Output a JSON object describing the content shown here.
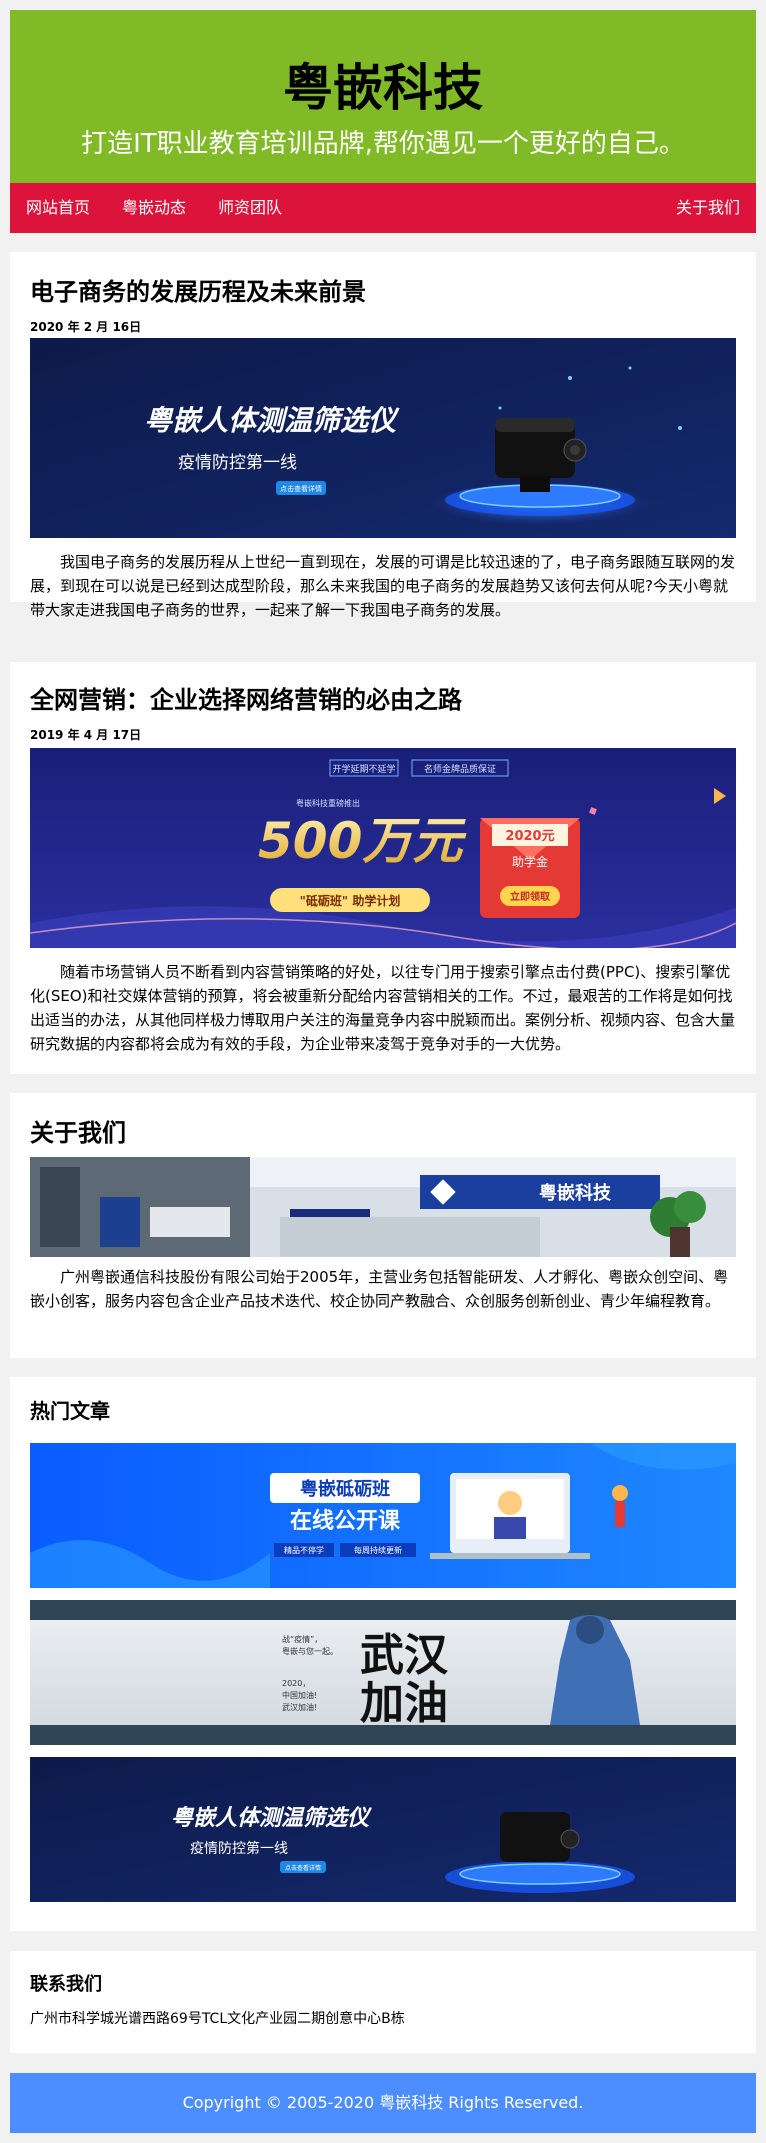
{
  "header": {
    "title": "粤嵌科技",
    "slogan": "打造IT职业教育培训品牌,帮你遇见一个更好的自己。"
  },
  "nav": {
    "items": [
      "网站首页",
      "粤嵌动态",
      "师资团队"
    ],
    "right": "关于我们"
  },
  "colors": {
    "header_bg": "#80ba26",
    "nav_bg": "#dc143c",
    "footer_bg": "#4c8dff"
  },
  "articles": [
    {
      "title": "电子商务的发展历程及未来前景",
      "date": "2020 年 2 月 16日",
      "body": "我国电子商务的发展历程从上世纪一直到现在，发展的可谓是比较迅速的了，电子商务跟随互联网的发展，到现在可以说是已经到达成型阶段，那么未来我国的电子商务的发展趋势又该何去何从呢?今天小粤就带大家走进我国电子商务的世界，一起来了解一下我国电子商务的发展。",
      "banner": {
        "headline": "粤嵌人体测温筛选仪",
        "sub": "疫情防控第一线",
        "button": "点击查看详情"
      }
    },
    {
      "title": "全网营销：企业选择网络营销的必由之路",
      "date": "2019 年 4 月 17日",
      "body": "随着市场营销人员不断看到内容营销策略的好处，以往专门用于搜索引擎点击付费(PPC)、搜索引擎优化(SEO)和社交媒体营销的预算，将会被重新分配给内容营销相关的工作。不过，最艰苦的工作将是如何找出适当的办法，从其他同样极力博取用户关注的海量竞争内容中脱颖而出。案例分析、视频内容、包含大量研究数据的内容都将会成为有效的手段，为企业带来凌驾于竞争对手的一大优势。",
      "banner": {
        "tag1": "开学延期不延学",
        "tag2": "名师金牌品质保证",
        "top": "粤嵌科技重磅推出",
        "amount": "500万元",
        "plan": "\"砥砺班\" 助学计划",
        "envelope_year": "2020元",
        "envelope_label": "助学金",
        "envelope_button": "立即领取"
      }
    }
  ],
  "about": {
    "title": "关于我们",
    "body": "广州粤嵌通信科技股份有限公司始于2005年，主营业务包括智能研发、人才孵化、粤嵌众创空间、粤嵌小创客，服务内容包含企业产品技术迭代、校企协同产教融合、众创服务创新创业、青少年编程教育。",
    "banner_logo": "粤嵌科技"
  },
  "hot": {
    "title": "热门文章",
    "banner1": {
      "line1": "粤嵌砥砺班",
      "line2": "在线公开课",
      "btn1": "精品不停学",
      "btn2": "每周持续更新"
    },
    "banner2": {
      "side1": "战“疫情”，",
      "side2": "粤嵌与您一起。",
      "side3": "2020，",
      "side4": "中国加油!",
      "side5": "武汉加油!",
      "big1": "武汉",
      "big2": "加油"
    },
    "banner3": {
      "headline": "粤嵌人体测温筛选仪",
      "sub": "疫情防控第一线",
      "button": "点击查看详情"
    }
  },
  "contact": {
    "title": "联系我们",
    "address": "广州市科学城光谱西路69号TCL文化产业园二期创意中心B栋"
  },
  "footer": {
    "copyright": "Copyright © 2005-2020 粤嵌科技 Rights Reserved."
  }
}
